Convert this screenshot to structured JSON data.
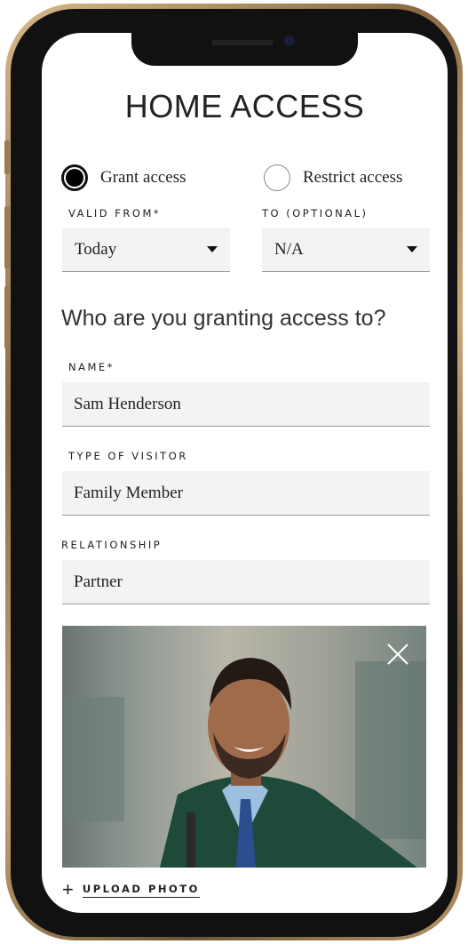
{
  "screen": {
    "title": "HOME ACCESS"
  },
  "access": {
    "grant_label": "Grant access",
    "restrict_label": "Restrict access",
    "selected": "grant"
  },
  "valid": {
    "from_label": "VALID FROM*",
    "from_value": "Today",
    "to_label": "TO (OPTIONAL)",
    "to_value": "N/A"
  },
  "visitor": {
    "question": "Who are you granting access to?",
    "name_label": "NAME*",
    "name_value": "Sam Henderson",
    "type_label": "TYPE OF VISITOR",
    "type_value": "Family Member",
    "relationship_label": "RELATIONSHIP",
    "relationship_value": "Partner"
  },
  "photo": {
    "upload_label": "UPLOAD PHOTO"
  },
  "colors": {
    "frame_gold": "#c9a978",
    "field_bg": "#f3f3f3",
    "text": "#222222",
    "jacket": "#1e4a3a",
    "shirt": "#9ec0e0",
    "tie": "#2c4e8e"
  },
  "icons": [
    "chevron-down-icon",
    "close-icon",
    "plus-icon"
  ]
}
